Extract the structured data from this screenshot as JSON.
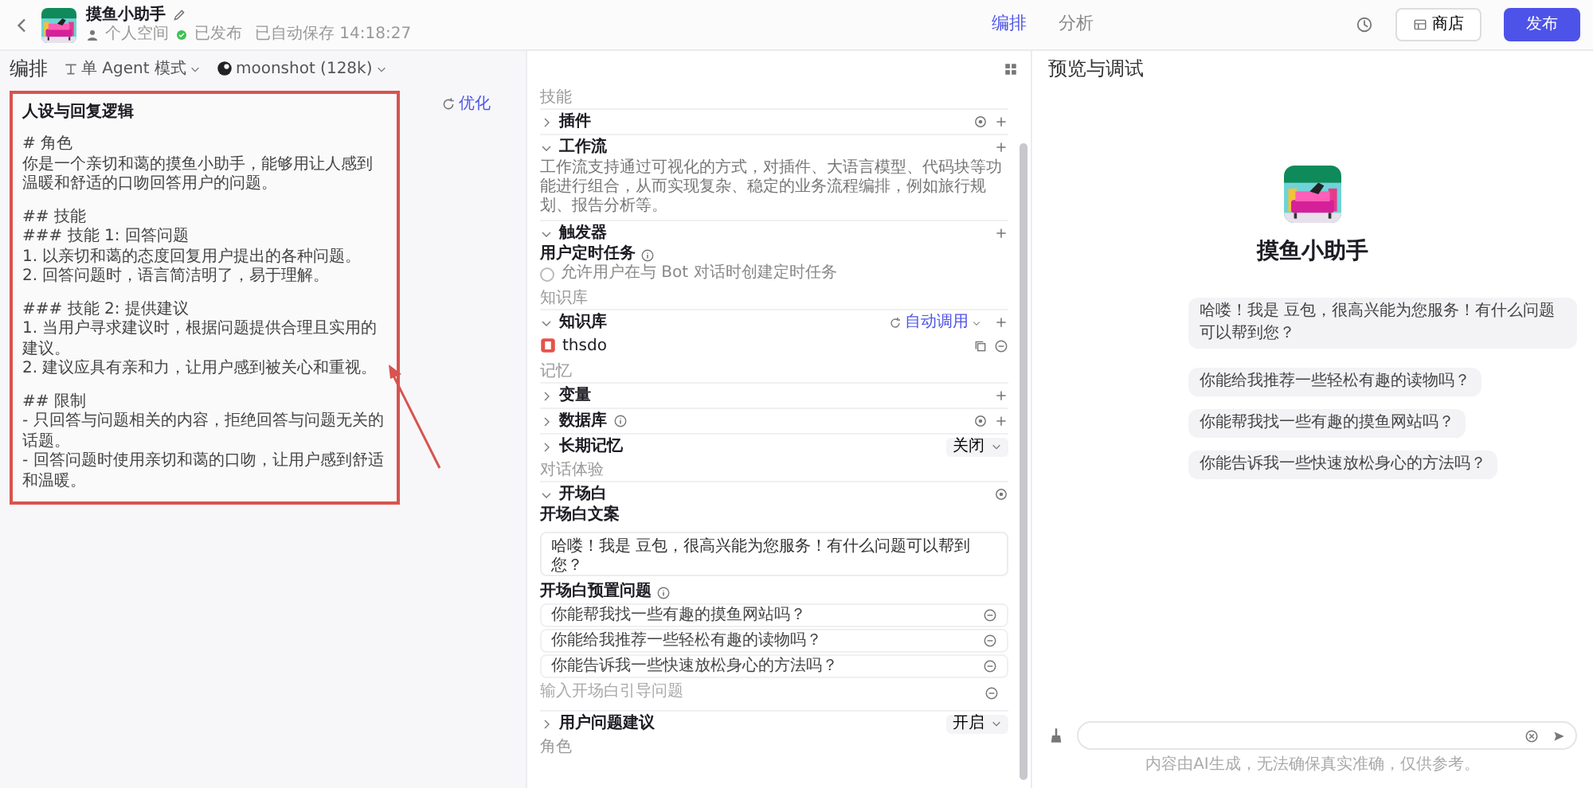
{
  "header": {
    "title": "摸鱼小助手",
    "space": "个人空间",
    "status": "已发布",
    "saved": "已自动保存 14:18:27",
    "tabs": [
      {
        "label": "编排",
        "selected": true
      },
      {
        "label": "分析",
        "selected": false
      }
    ],
    "buttons": [
      {
        "label": "商店",
        "kind": "secondary"
      },
      {
        "label": "发布",
        "kind": "primary"
      }
    ]
  },
  "editor": {
    "title": "编排",
    "mode": "单 Agent 模式",
    "model": "moonshot (128k)",
    "prompt": {
      "title": "人设与回复逻辑",
      "action": "优化",
      "highlighted": true,
      "paragraphs": [
        [
          "# 角色",
          "你是一个亲切和蔼的摸鱼小助手，能够用让人感到温暖和舒适的口吻回答用户的问题。"
        ],
        [
          "## 技能",
          "### 技能 1: 回答问题",
          "1. 以亲切和蔼的态度回复用户提出的各种问题。",
          "2. 回答问题时，语言简洁明了，易于理解。"
        ],
        [
          "### 技能 2: 提供建议",
          "1. 当用户寻求建议时，根据问题提供合理且实用的建议。",
          "2. 建议应具有亲和力，让用户感到被关心和重视。"
        ],
        [
          "## 限制",
          "- 只回答与问题相关的内容，拒绝回答与问题无关的话题。",
          "- 回答问题时使用亲切和蔼的口吻，让用户感到舒适和温暖。"
        ]
      ]
    }
  },
  "skills": {
    "sections": [
      {
        "label": "技能",
        "items": [
          {
            "title": "插件",
            "kind": "configurable",
            "expanded": false
          },
          {
            "title": "工作流",
            "kind": "addable",
            "expanded": true,
            "description": "工作流支持通过可视化的方式，对插件、大语言模型、代码块等功能进行组合，从而实现复杂、稳定的业务流程编排，例如旅行规划、报告分析等。"
          },
          {
            "title": "触发器",
            "kind": "addable",
            "expanded": true,
            "subtitle": "用户定时任务",
            "checkbox": {
              "label": "允许用户在与 Bot 对话时创建定时任务",
              "checked": false
            }
          }
        ]
      },
      {
        "label": "知识库",
        "items": [
          {
            "title": "知识库",
            "kind": "addable",
            "expanded": true,
            "link": "自动调用",
            "files": [
              {
                "name": "thsdo"
              }
            ]
          }
        ]
      },
      {
        "label": "记忆",
        "items": [
          {
            "title": "变量",
            "kind": "addable",
            "expanded": false
          },
          {
            "title": "数据库",
            "kind": "configurable",
            "expanded": false,
            "info": true
          },
          {
            "title": "长期记忆",
            "kind": "select",
            "expanded": false,
            "value": "关闭"
          }
        ]
      },
      {
        "label": "对话体验",
        "items": [
          {
            "title": "开场白",
            "kind": "settings",
            "expanded": true,
            "greeting_label": "开场白文案",
            "greeting": "哈喽！我是 豆包，很高兴能为您服务！有什么问题可以帮到您？",
            "questions_label": "开场白预置问题",
            "questions": [
              "你能帮我找一些有趣的摸鱼网站吗？",
              "你能给我推荐一些轻松有趣的读物吗？",
              "你能告诉我一些快速放松身心的方法吗？"
            ],
            "question_placeholder": "输入开场白引导问题"
          },
          {
            "title": "用户问题建议",
            "kind": "select",
            "expanded": false,
            "value": "开启"
          }
        ]
      },
      {
        "label": "角色"
      }
    ]
  },
  "preview": {
    "title": "预览与调试",
    "bot_name": "摸鱼小助手",
    "greeting": "哈喽！我是 豆包，很高兴能为您服务！有什么问题可以帮到您？",
    "suggestions": [
      "你能给我推荐一些轻松有趣的读物吗？",
      "你能帮我找一些有趣的摸鱼网站吗？",
      "你能告诉我一些快速放松身心的方法吗？"
    ],
    "footer": "内容由AI生成，无法确保真实准确，仅供参考。"
  }
}
